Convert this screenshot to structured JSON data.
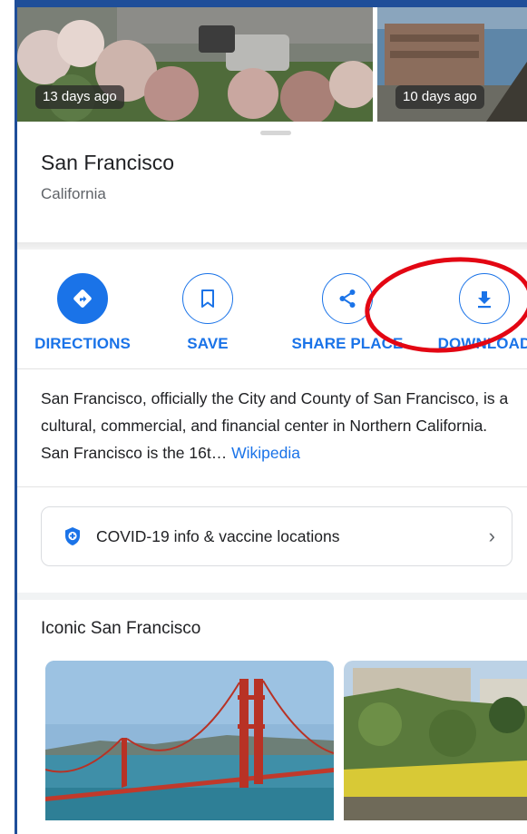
{
  "photos": [
    {
      "time_label": "13 days ago"
    },
    {
      "time_label": "10 days ago"
    }
  ],
  "place": {
    "name": "San Francisco",
    "region": "California"
  },
  "actions": [
    {
      "label": "DIRECTIONS",
      "icon": "directions-icon"
    },
    {
      "label": "SAVE",
      "icon": "bookmark-icon"
    },
    {
      "label": "SHARE PLACE",
      "icon": "share-icon"
    },
    {
      "label": "DOWNLOAD",
      "icon": "download-icon"
    }
  ],
  "description": {
    "text": "San Francisco, officially the City and County of San Francisco, is a cultural, commercial, and financial center in Northern California. San Francisco is the 16t…",
    "link": "Wikipedia"
  },
  "covid_card": {
    "text": "COVID-19 info & vaccine locations",
    "icon": "shield-plus-icon"
  },
  "section": {
    "title": "Iconic San Francisco"
  },
  "colors": {
    "accent": "#1a73e8",
    "annotation": "#e30613"
  }
}
